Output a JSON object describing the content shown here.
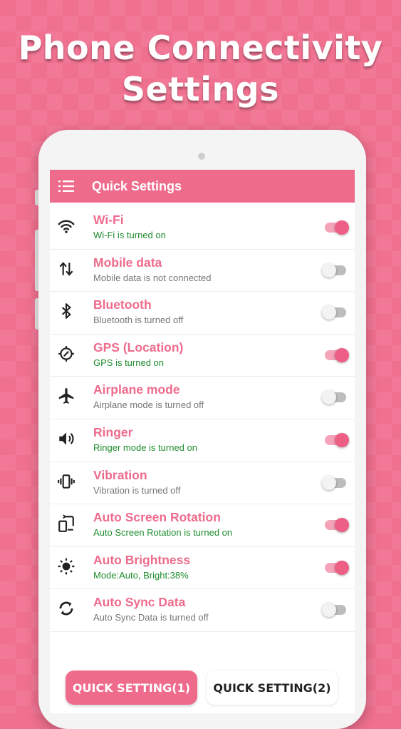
{
  "promo": {
    "line1": "Phone Connectivity",
    "line2": "Settings"
  },
  "appbar": {
    "title": "Quick Settings",
    "menu_icon": "menu-icon"
  },
  "colors": {
    "accent": "#ee6b8c",
    "background": "#f0708f",
    "on_text": "#1e8c2e",
    "off_text": "#777777"
  },
  "settings": [
    {
      "icon": "wifi-icon",
      "title": "Wi-Fi",
      "subtitle": "Wi-Fi is turned on",
      "enabled": true
    },
    {
      "icon": "mobile-data-icon",
      "title": "Mobile data",
      "subtitle": "Mobile data is not connected",
      "enabled": false
    },
    {
      "icon": "bluetooth-icon",
      "title": "Bluetooth",
      "subtitle": "Bluetooth is turned off",
      "enabled": false
    },
    {
      "icon": "gps-icon",
      "title": "GPS (Location)",
      "subtitle": "GPS is turned on",
      "enabled": true
    },
    {
      "icon": "airplane-icon",
      "title": "Airplane mode",
      "subtitle": "Airplane mode is turned off",
      "enabled": false
    },
    {
      "icon": "ringer-icon",
      "title": "Ringer",
      "subtitle": "Ringer mode is turned on",
      "enabled": true
    },
    {
      "icon": "vibration-icon",
      "title": "Vibration",
      "subtitle": "Vibration is turned off",
      "enabled": false
    },
    {
      "icon": "screen-rotation-icon",
      "title": "Auto Screen Rotation",
      "subtitle": "Auto Screen Rotation is turned on",
      "enabled": true
    },
    {
      "icon": "brightness-icon",
      "title": "Auto Brightness",
      "subtitle": "Mode:Auto, Bright:38%",
      "enabled": true
    },
    {
      "icon": "sync-icon",
      "title": "Auto Sync Data",
      "subtitle": "Auto Sync Data is turned off",
      "enabled": false
    }
  ],
  "buttons": {
    "quick_setting_1": "QUICK SETTING(1)",
    "quick_setting_2": "QUICK SETTING(2)"
  }
}
